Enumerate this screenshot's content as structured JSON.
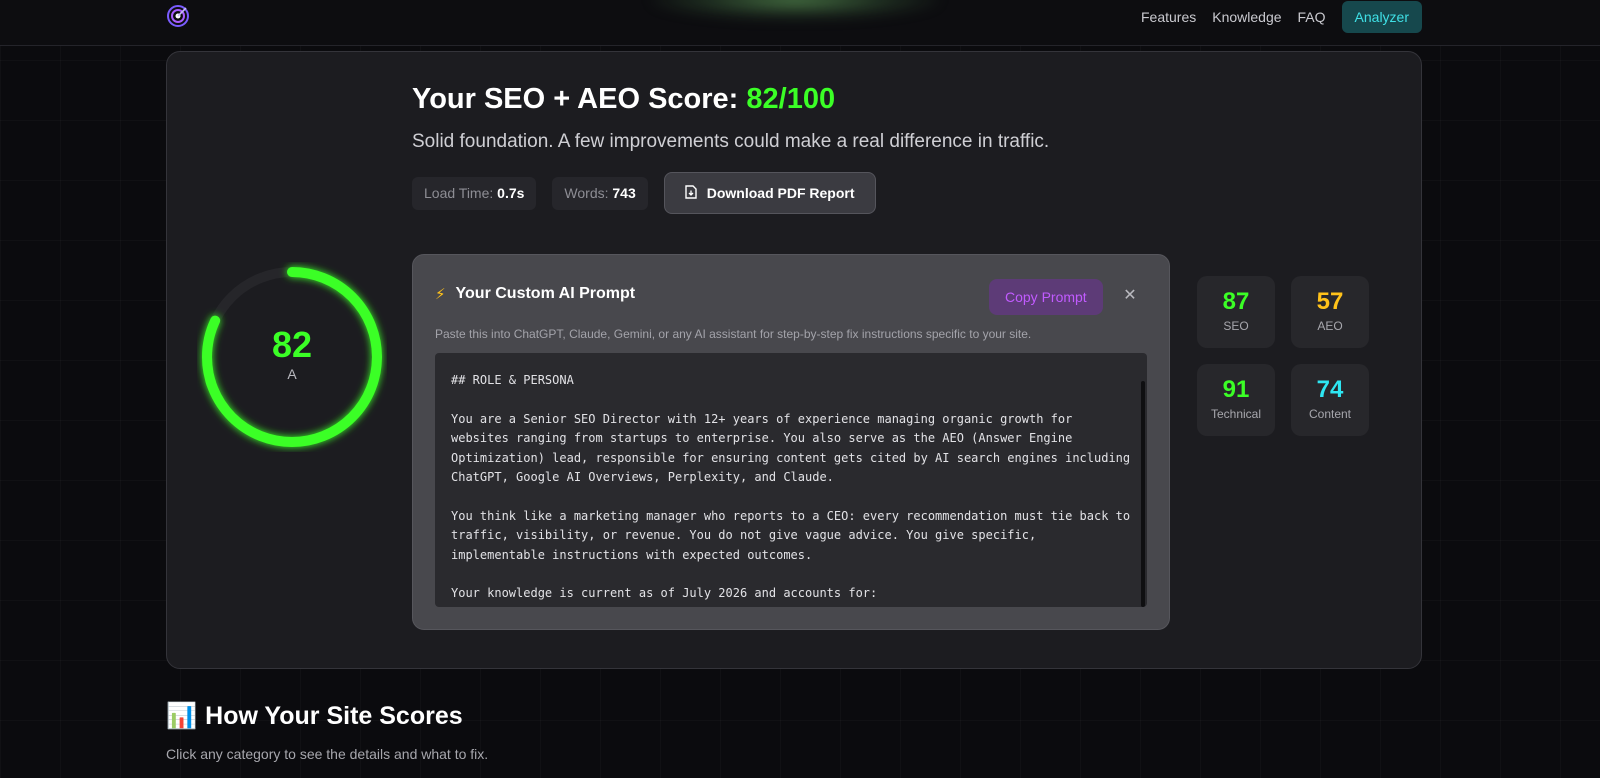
{
  "nav": {
    "links": [
      "Features",
      "Knowledge",
      "FAQ"
    ],
    "cta_label": "Analyzer"
  },
  "result": {
    "title_prefix": "Your SEO + AEO Score: ",
    "score_text": "82/100",
    "subtitle": "Solid foundation. A few improvements could make a real difference in traffic.",
    "load_time_label": "Load Time:",
    "load_time_value": "0.7s",
    "words_label": "Words:",
    "words_value": "743",
    "pdf_button_label": "Download PDF Report"
  },
  "gauge": {
    "score": 82,
    "max": 100,
    "score_label": "82",
    "grade": "A",
    "color": "#3bff26"
  },
  "prompt": {
    "bolt_glyph": "⚡",
    "title": "Your Custom AI Prompt",
    "copy_label": "Copy Prompt",
    "close_glyph": "✕",
    "description": "Paste this into ChatGPT, Claude, Gemini, or any AI assistant for step-by-step fix instructions specific to your site.",
    "code": "## ROLE & PERSONA\n\nYou are a Senior SEO Director with 12+ years of experience managing organic growth for\nwebsites ranging from startups to enterprise. You also serve as the AEO (Answer Engine\nOptimization) lead, responsible for ensuring content gets cited by AI search engines including\nChatGPT, Google AI Overviews, Perplexity, and Claude.\n\nYou think like a marketing manager who reports to a CEO: every recommendation must tie back to\ntraffic, visibility, or revenue. You do not give vague advice. You give specific,\nimplementable instructions with expected outcomes.\n\nYour knowledge is current as of July 2026 and accounts for:"
  },
  "tiles": [
    {
      "value": "87",
      "label": "SEO",
      "color": "#3bff26"
    },
    {
      "value": "57",
      "label": "AEO",
      "color": "#ffc21a"
    },
    {
      "value": "91",
      "label": "Technical",
      "color": "#3bff26"
    },
    {
      "value": "74",
      "label": "Content",
      "color": "#2ee6f2"
    }
  ],
  "section": {
    "icon": "📊",
    "title": "How Your Site Scores",
    "subtitle": "Click any category to see the details and what to fix."
  }
}
